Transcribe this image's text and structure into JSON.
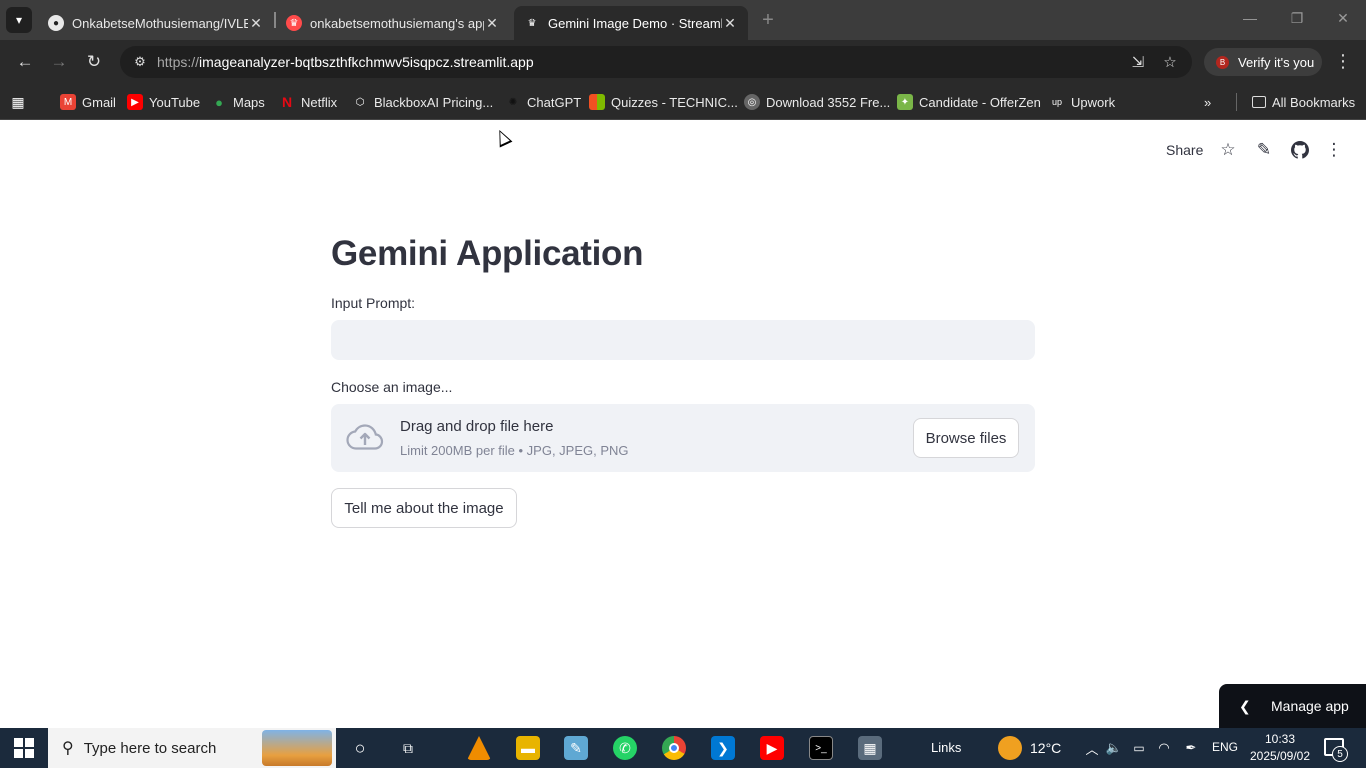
{
  "browser": {
    "tabs": [
      {
        "title": "OnkabetseMothusiemang/IVLE",
        "icon": "github-icon"
      },
      {
        "title": "onkabetsemothusiemang's app",
        "icon": "streamlit-crown-icon"
      },
      {
        "title": "Gemini Image Demo · Streamlit",
        "icon": "streamlit-crown-icon",
        "active": true
      }
    ],
    "url_scheme": "https://",
    "url_rest": "imageanalyzer-bqtbszthfkchmwv5isqpcz.streamlit.app",
    "verify_label": "Verify it's you",
    "verify_avatar": "B",
    "bookmarks": [
      {
        "label": "Gmail",
        "icon": "gmail-icon",
        "color": "#ea4335"
      },
      {
        "label": "YouTube",
        "icon": "youtube-icon",
        "color": "#ff0000"
      },
      {
        "label": "Maps",
        "icon": "maps-pin-icon",
        "color": "#34a853"
      },
      {
        "label": "Netflix",
        "icon": "netflix-icon",
        "color": "#e50914"
      },
      {
        "label": "BlackboxAI Pricing...",
        "icon": "blackbox-icon",
        "color": "#2a2a2a"
      },
      {
        "label": "ChatGPT",
        "icon": "chatgpt-icon",
        "color": "#2a2a2a"
      },
      {
        "label": "Quizzes - TECHNIC...",
        "icon": "microsoft-icon",
        "color": "#f25022"
      },
      {
        "label": "Download 3552 Fre...",
        "icon": "globe-icon",
        "color": "#555"
      },
      {
        "label": "Candidate - OfferZen",
        "icon": "offerzen-icon",
        "color": "#7ab648"
      },
      {
        "label": "Upwork",
        "icon": "upwork-icon",
        "color": "#2a2a2a"
      }
    ],
    "all_bookmarks_label": "All Bookmarks"
  },
  "header": {
    "share_label": "Share"
  },
  "main": {
    "title": "Gemini Application",
    "prompt_label": "Input Prompt:",
    "prompt_value": "",
    "image_label": "Choose an image...",
    "dropzone_title": "Drag and drop file here",
    "dropzone_limit": "Limit 200MB per file • JPG, JPEG, PNG",
    "browse_label": "Browse files",
    "submit_label": "Tell me about the image"
  },
  "manage_app_label": "Manage app",
  "taskbar": {
    "search_placeholder": "Type here to search",
    "links_label": "Links",
    "temperature": "12°C",
    "language": "ENG",
    "time": "10:33",
    "date": "2025/09/02",
    "notification_count": "5"
  },
  "colors": {
    "streamlit_text": "#31333f",
    "input_bg": "#f0f2f6",
    "manage_bg": "#0e1117",
    "taskbar_bg": "#1b2a3c"
  }
}
